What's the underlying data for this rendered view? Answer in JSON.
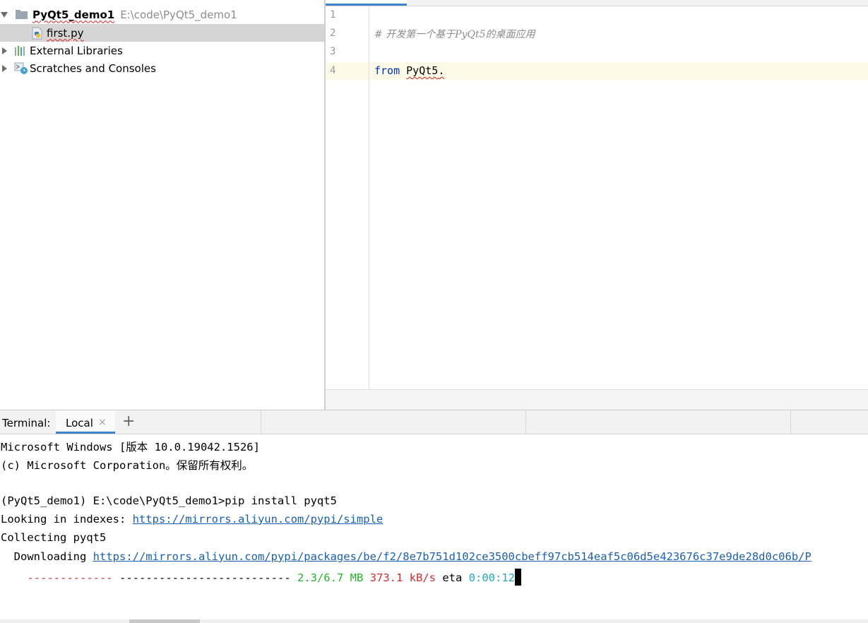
{
  "project_tree": {
    "root": {
      "name": "PyQt5_demo1",
      "path": "E:\\code\\PyQt5_demo1"
    },
    "file": {
      "name": "first.py"
    },
    "external_libraries": "External Libraries",
    "scratches": "Scratches and Consoles"
  },
  "editor": {
    "line_numbers": [
      "1",
      "2",
      "3",
      "4"
    ],
    "comment": "# 开发第一个基于PyQt5的桌面应用",
    "keyword_from": "from",
    "module": "PyQt5",
    "dot": "."
  },
  "terminal": {
    "label": "Terminal:",
    "tab": "Local",
    "tab_close_icon": "×",
    "new_tab_icon": "+",
    "lines": {
      "l1": "Microsoft Windows [版本 10.0.19042.1526]",
      "l2": "(c) Microsoft Corporation。保留所有权利。",
      "l4": "(PyQt5_demo1) E:\\code\\PyQt5_demo1>pip install pyqt5",
      "l5_prefix": "Looking in indexes: ",
      "l5_link": "https://mirrors.aliyun.com/pypi/simple",
      "l6": "Collecting pyqt5",
      "l7_prefix": "  Downloading ",
      "l7_link": "https://mirrors.aliyun.com/pypi/packages/be/f2/8e7b751d102ce3500cbeff97cb514eaf5c06d5e423676c37e9de28d0c06b/P",
      "l8_bar_done": "-------------",
      "l8_bar_rest": "--------------------------",
      "l8_size": "2.3/6.7 MB",
      "l8_speed": "373.1 kB/s",
      "l8_eta_label": "eta",
      "l8_eta": "0:00:12"
    },
    "progress": 0.34
  },
  "colors": {
    "selection": "#d5d5d5",
    "accent": "#4083c9",
    "keyword": "#0033b3",
    "link": "#1a5fb4",
    "red": "#cd3131",
    "green": "#27b32a",
    "cyan": "#22a8c9"
  },
  "icons": {
    "folder": "folder-icon",
    "python_file": "python-file-icon",
    "libraries": "libraries-icon",
    "scratches": "scratches-icon"
  }
}
